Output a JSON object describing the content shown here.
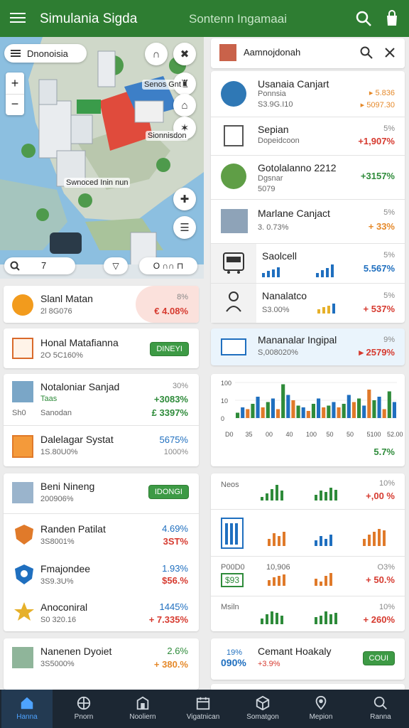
{
  "header": {
    "title": "Simulania Sigda",
    "subtitle": "Sontenn Ingamaai"
  },
  "map": {
    "search_chip": "Dnonoisia",
    "labels": [
      "Senos Gnt",
      "Sionnisdon",
      "Swnoced Inin nun"
    ],
    "toolbar_left_value": "7",
    "toolbar_mid": "▽",
    "toolbar_right": "O ∩∩ ⊓"
  },
  "left_cards": [
    {
      "name": "Slanl Matan",
      "meta": "2l 8G076",
      "pct": "8%",
      "value": "€ 4.08%"
    },
    {
      "name": "Honal Matafianna",
      "meta": "2O 5C160%",
      "badge": "DINEYI"
    },
    {
      "name": "Notaloniar Sanjad",
      "meta": "Taas",
      "pct": "30%",
      "value": "+3083%",
      "meta2": "Sanodan",
      "meta2_prefix": "Sh0",
      "value2": "£ 3397%"
    },
    {
      "name": "Dalelagar Systat",
      "meta": "1S.80U0%",
      "pct": "5675%",
      "value": "1000%"
    },
    {
      "name": "Beni Nineng",
      "meta": "200906%",
      "badge": "IDONGI"
    },
    {
      "name": "Randen Patilat",
      "meta": "3S8001%",
      "pct": "4.69%",
      "value": "3ST%"
    },
    {
      "name": "Fmajondee",
      "meta": "3S9.3U%",
      "pct": "1.93%",
      "value": "$56.%"
    },
    {
      "name": "Anoconiral",
      "meta": "S0 320.16",
      "pct": "1445%",
      "value": "+ 7.335%"
    },
    {
      "name": "Nanenen Dyoiet",
      "meta": "3S5000%",
      "pct": "2.6%",
      "value": "+ 380.%"
    }
  ],
  "right_panel": {
    "search": "Aamnojdonah",
    "items": [
      {
        "name": "Usanaia Canjart",
        "meta": "Ponnsia",
        "meta2": "S3.9G.I10",
        "pct": "▸ 5.836",
        "value": "▸ 5097.30"
      },
      {
        "name": "Sepian",
        "meta": "Dopeidcoon",
        "pct": "5%",
        "value": "+1,907%"
      },
      {
        "name": "Gotolalanno 2212",
        "meta": "Dgsnar",
        "meta2": "5079",
        "value": "+3157%"
      },
      {
        "name": "Marlane Canjact",
        "meta": "3. 0.73%",
        "pct": "5%",
        "value": "+ 33%"
      },
      {
        "name": "Saolcell",
        "meta": "",
        "pct": "5%",
        "value": "5.567%"
      },
      {
        "name": "Nanalatco",
        "meta": "S3.00%",
        "pct": "5%",
        "value": "+ 537%"
      }
    ],
    "highlight": {
      "name": "Mananalar Ingipal",
      "meta": "S,008020%",
      "pct": "9%",
      "value": "▸ 2579%"
    }
  },
  "chart_data": {
    "type": "bar",
    "y_ticks": [
      "100",
      "10",
      "0"
    ],
    "x_ticks": [
      "D0",
      "35",
      "00",
      "40",
      "100",
      "50",
      "50",
      "5100",
      "52.00"
    ],
    "values": [
      6,
      12,
      10,
      16,
      24,
      12,
      18,
      22,
      10,
      38,
      26,
      20,
      14,
      12,
      8,
      16,
      22,
      12,
      14,
      18,
      12,
      16,
      26,
      18,
      22,
      14,
      32,
      20,
      24,
      10,
      30,
      18
    ],
    "footer": "5.7%"
  },
  "mini_charts": [
    {
      "label": "Neos",
      "value": "+,00 %",
      "pct": "10%"
    },
    {
      "label": "",
      "value": "",
      "pct": ""
    },
    {
      "label": "P00D0",
      "label2": "$93",
      "mid": "10,906",
      "value": "+ 50.%",
      "pct": "O3%"
    },
    {
      "label": "Msiln",
      "value": "+ 260%",
      "pct": "10%"
    }
  ],
  "bottom_right": {
    "pct": "19%",
    "big": "090%",
    "name": "Cemant Hoakaly",
    "meta": "+3.9%",
    "badge": "COUI"
  },
  "nav": [
    "Hanna",
    "Pnorn",
    "Nooliern",
    "Vigatnican",
    "Somatgon",
    "Mepion",
    "Ranna"
  ],
  "colors": {
    "brand_green": "#2e7d32",
    "nav_bg": "#1c2733",
    "active_nav": "#4ea3ff"
  }
}
